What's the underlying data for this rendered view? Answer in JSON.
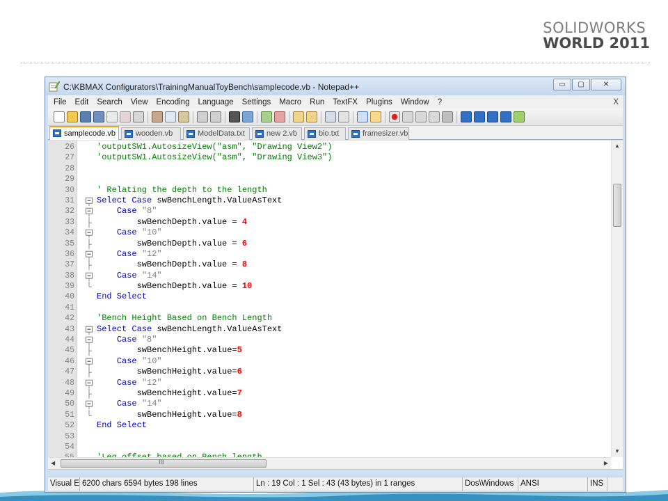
{
  "brand": {
    "line1": "SOLIDWORKS",
    "line2": "WORLD 2011"
  },
  "window": {
    "title": "C:\\KBMAX Configurators\\TrainingManualToyBench\\samplecode.vb - Notepad++",
    "buttons": {
      "minimize": "▭",
      "maximize": "▢",
      "close": "✕"
    }
  },
  "menu": {
    "items": [
      "File",
      "Edit",
      "Search",
      "View",
      "Encoding",
      "Language",
      "Settings",
      "Macro",
      "Run",
      "TextFX",
      "Plugins",
      "Window",
      "?"
    ],
    "close_label": "X"
  },
  "tabs": [
    {
      "label": "samplecode.vb",
      "active": true
    },
    {
      "label": "wooden.vb",
      "active": false
    },
    {
      "label": "ModelData.txt",
      "active": false
    },
    {
      "label": "new  2.vb",
      "active": false
    },
    {
      "label": "bio.txt",
      "active": false
    },
    {
      "label": "framesizer.vb",
      "active": false
    }
  ],
  "editor": {
    "lines": [
      {
        "n": "26",
        "fold": "",
        "tokens": [
          [
            "comment",
            "'outputSW1.AutosizeView(\"asm\", \"Drawing View2\")"
          ]
        ]
      },
      {
        "n": "27",
        "fold": "",
        "tokens": [
          [
            "comment",
            "'outputSW1.AutosizeView(\"asm\", \"Drawing View3\")"
          ]
        ]
      },
      {
        "n": "28",
        "fold": "",
        "tokens": []
      },
      {
        "n": "29",
        "fold": "",
        "tokens": []
      },
      {
        "n": "30",
        "fold": "",
        "tokens": [
          [
            "comment",
            "' Relating the depth to the length"
          ]
        ]
      },
      {
        "n": "31",
        "fold": "box",
        "tokens": [
          [
            "kw",
            "Select Case "
          ],
          [
            "default",
            "swBenchLength.ValueAsText"
          ]
        ]
      },
      {
        "n": "32",
        "fold": "box",
        "tokens": [
          [
            "default",
            "    "
          ],
          [
            "kw",
            "Case "
          ],
          [
            "str",
            "\"8\""
          ]
        ]
      },
      {
        "n": "33",
        "fold": "line",
        "tokens": [
          [
            "default",
            "        swBenchDepth.value = "
          ],
          [
            "num",
            "4"
          ]
        ]
      },
      {
        "n": "34",
        "fold": "box",
        "tokens": [
          [
            "default",
            "    "
          ],
          [
            "kw",
            "Case "
          ],
          [
            "str",
            "\"10\""
          ]
        ]
      },
      {
        "n": "35",
        "fold": "line",
        "tokens": [
          [
            "default",
            "        swBenchDepth.value = "
          ],
          [
            "num",
            "6"
          ]
        ]
      },
      {
        "n": "36",
        "fold": "box",
        "tokens": [
          [
            "default",
            "    "
          ],
          [
            "kw",
            "Case "
          ],
          [
            "str",
            "\"12\""
          ]
        ]
      },
      {
        "n": "37",
        "fold": "line",
        "tokens": [
          [
            "default",
            "        swBenchDepth.value = "
          ],
          [
            "num",
            "8"
          ]
        ]
      },
      {
        "n": "38",
        "fold": "box",
        "tokens": [
          [
            "default",
            "    "
          ],
          [
            "kw",
            "Case "
          ],
          [
            "str",
            "\"14\""
          ]
        ]
      },
      {
        "n": "39",
        "fold": "end",
        "tokens": [
          [
            "default",
            "        swBenchDepth.value = "
          ],
          [
            "num",
            "10"
          ]
        ]
      },
      {
        "n": "40",
        "fold": "",
        "tokens": [
          [
            "kw",
            "End Select"
          ]
        ]
      },
      {
        "n": "41",
        "fold": "",
        "tokens": []
      },
      {
        "n": "42",
        "fold": "",
        "tokens": [
          [
            "comment",
            "'Bench Height Based on Bench Length"
          ]
        ]
      },
      {
        "n": "43",
        "fold": "box",
        "tokens": [
          [
            "kw",
            "Select Case "
          ],
          [
            "default",
            "swBenchLength.ValueAsText"
          ]
        ]
      },
      {
        "n": "44",
        "fold": "box",
        "tokens": [
          [
            "default",
            "    "
          ],
          [
            "kw",
            "Case "
          ],
          [
            "str",
            "\"8\""
          ]
        ]
      },
      {
        "n": "45",
        "fold": "line",
        "tokens": [
          [
            "default",
            "        swBenchHeight.value="
          ],
          [
            "num",
            "5"
          ]
        ]
      },
      {
        "n": "46",
        "fold": "box",
        "tokens": [
          [
            "default",
            "    "
          ],
          [
            "kw",
            "Case "
          ],
          [
            "str",
            "\"10\""
          ]
        ]
      },
      {
        "n": "47",
        "fold": "line",
        "tokens": [
          [
            "default",
            "        swBenchHeight.value="
          ],
          [
            "num",
            "6"
          ]
        ]
      },
      {
        "n": "48",
        "fold": "box",
        "tokens": [
          [
            "default",
            "    "
          ],
          [
            "kw",
            "Case "
          ],
          [
            "str",
            "\"12\""
          ]
        ]
      },
      {
        "n": "49",
        "fold": "line",
        "tokens": [
          [
            "default",
            "        swBenchHeight.value="
          ],
          [
            "num",
            "7"
          ]
        ]
      },
      {
        "n": "50",
        "fold": "box",
        "tokens": [
          [
            "default",
            "    "
          ],
          [
            "kw",
            "Case "
          ],
          [
            "str",
            "\"14\""
          ]
        ]
      },
      {
        "n": "51",
        "fold": "end",
        "tokens": [
          [
            "default",
            "        swBenchHeight.value="
          ],
          [
            "num",
            "8"
          ]
        ]
      },
      {
        "n": "52",
        "fold": "",
        "tokens": [
          [
            "kw",
            "End Select"
          ]
        ]
      },
      {
        "n": "53",
        "fold": "",
        "tokens": []
      },
      {
        "n": "54",
        "fold": "",
        "tokens": []
      },
      {
        "n": "55",
        "fold": "",
        "tokens": [
          [
            "comment",
            "'Leg offset based on Bench length"
          ]
        ]
      }
    ],
    "hscroll_grip": "III"
  },
  "status": {
    "type": "Visual E",
    "stats": "6200 chars  6594 bytes  198 lines",
    "position": "Ln : 19   Col : 1   Sel : 43 (43 bytes) in 1 ranges",
    "eol": "Dos\\Windows",
    "encoding": "ANSI",
    "mode": "INS"
  },
  "colors": {
    "comment": "#008000",
    "keyword": "#0000c8",
    "string": "#808080",
    "number": "#ff0000",
    "active_tab_accent": "#f3a31c"
  }
}
